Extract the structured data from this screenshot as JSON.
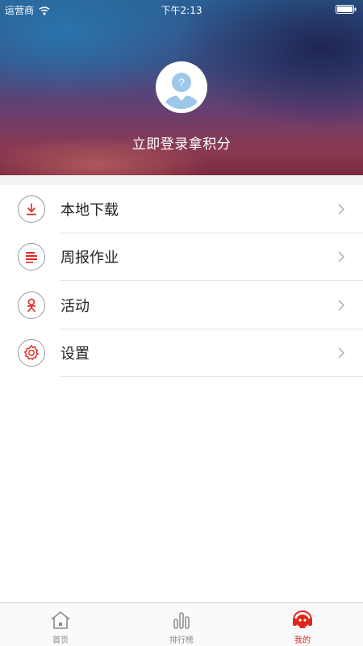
{
  "status_bar": {
    "carrier": "运营商",
    "time": "下午2:13"
  },
  "header": {
    "login_prompt": "立即登录拿积分"
  },
  "menu": {
    "items": [
      {
        "label": "本地下载",
        "icon": "download-icon"
      },
      {
        "label": "周报作业",
        "icon": "document-list-icon"
      },
      {
        "label": "活动",
        "icon": "activity-icon"
      },
      {
        "label": "设置",
        "icon": "gear-icon"
      }
    ]
  },
  "tabbar": {
    "tabs": [
      {
        "label": "首页",
        "icon": "home-icon",
        "active": false
      },
      {
        "label": "排行榜",
        "icon": "bar-chart-icon",
        "active": false
      },
      {
        "label": "我的",
        "icon": "profile-icon",
        "active": true
      }
    ]
  },
  "colors": {
    "accent": "#e1251b",
    "inactive": "#8a8a8a"
  }
}
